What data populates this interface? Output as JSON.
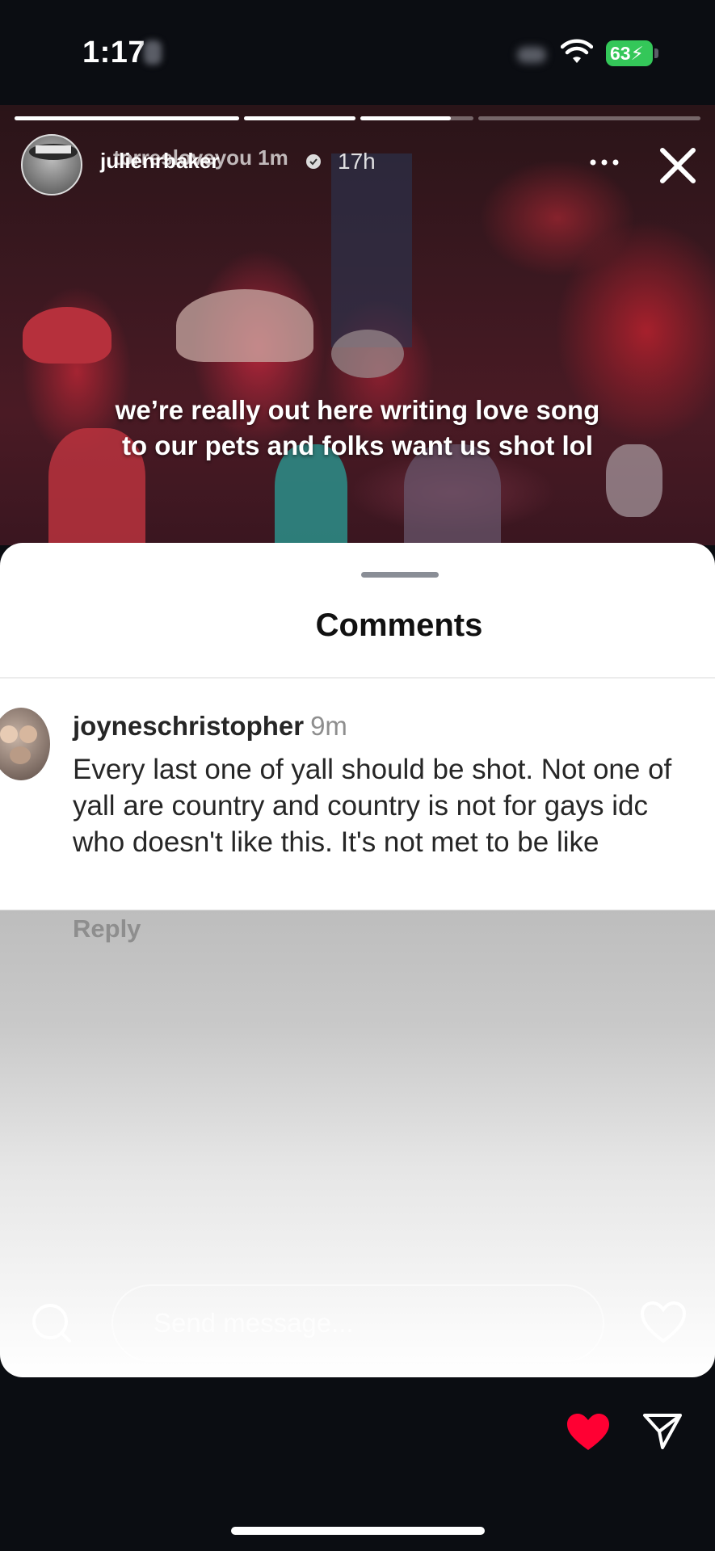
{
  "status_bar": {
    "time": "1:17",
    "battery": "63",
    "battery_color": "#34c759"
  },
  "story": {
    "username": "julienrbaker",
    "username_overlay": "torresloveyou 1m",
    "age": "17h",
    "caption_line1": "we’re really out here writing love song",
    "caption_line2": "to our pets and folks want us shot lol",
    "progress": [
      1.0,
      1.0,
      0.8,
      0.0
    ]
  },
  "comments": {
    "title": "Comments",
    "items": [
      {
        "username": "joyneschristopher",
        "time": "9m",
        "text": "Every last one of yall should be shot. Not one of yall are country and country is not for gays idc who doesn't like this. It's not met to be like",
        "reply_label": "Reply"
      }
    ]
  },
  "composer": {
    "placeholder": "Send message..."
  },
  "colors": {
    "like_red": "#ff0033"
  },
  "icons": [
    "wifi-icon",
    "verified-icon",
    "more-icon",
    "close-icon",
    "search-icon",
    "heart-outline-icon",
    "heart-filled-icon",
    "send-icon"
  ]
}
